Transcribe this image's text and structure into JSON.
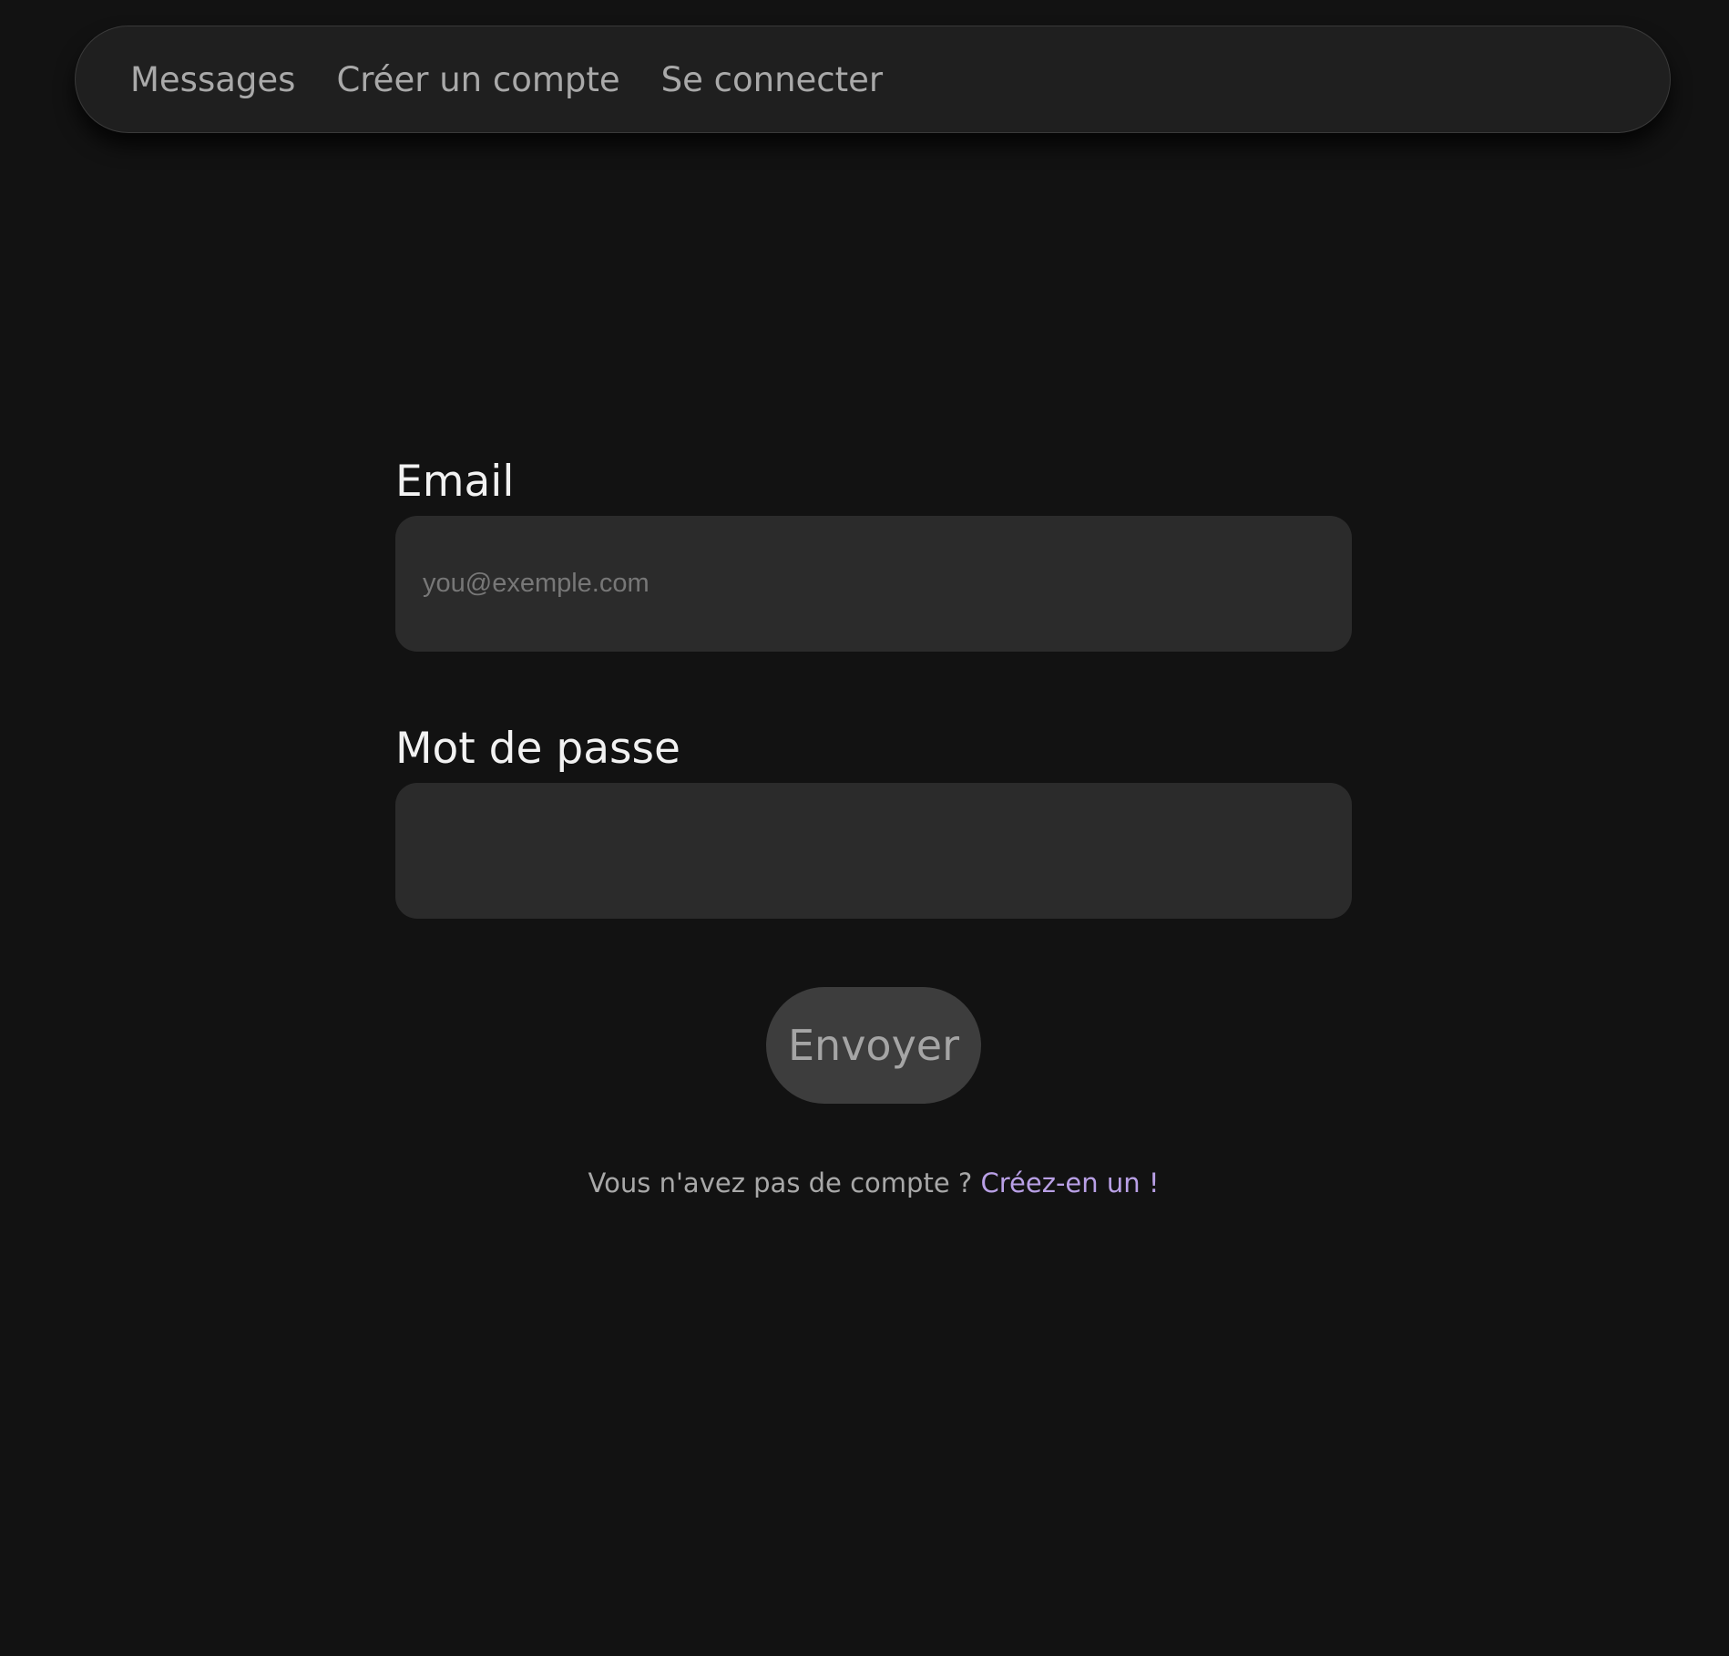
{
  "nav": {
    "items": [
      {
        "label": "Messages"
      },
      {
        "label": "Créer un compte"
      },
      {
        "label": "Se connecter"
      }
    ]
  },
  "form": {
    "email": {
      "label": "Email",
      "placeholder": "you@exemple.com",
      "value": ""
    },
    "password": {
      "label": "Mot de passe",
      "placeholder": "",
      "value": ""
    },
    "submit_label": "Envoyer"
  },
  "signup": {
    "prompt": "Vous n'avez pas de compte ?",
    "link_label": "Créez-en un !"
  },
  "colors": {
    "background": "#121212",
    "navbar": "#1f1f1f",
    "input": "#2b2b2b",
    "button": "#3d3d3d",
    "accent_link": "#b9a0e6"
  }
}
